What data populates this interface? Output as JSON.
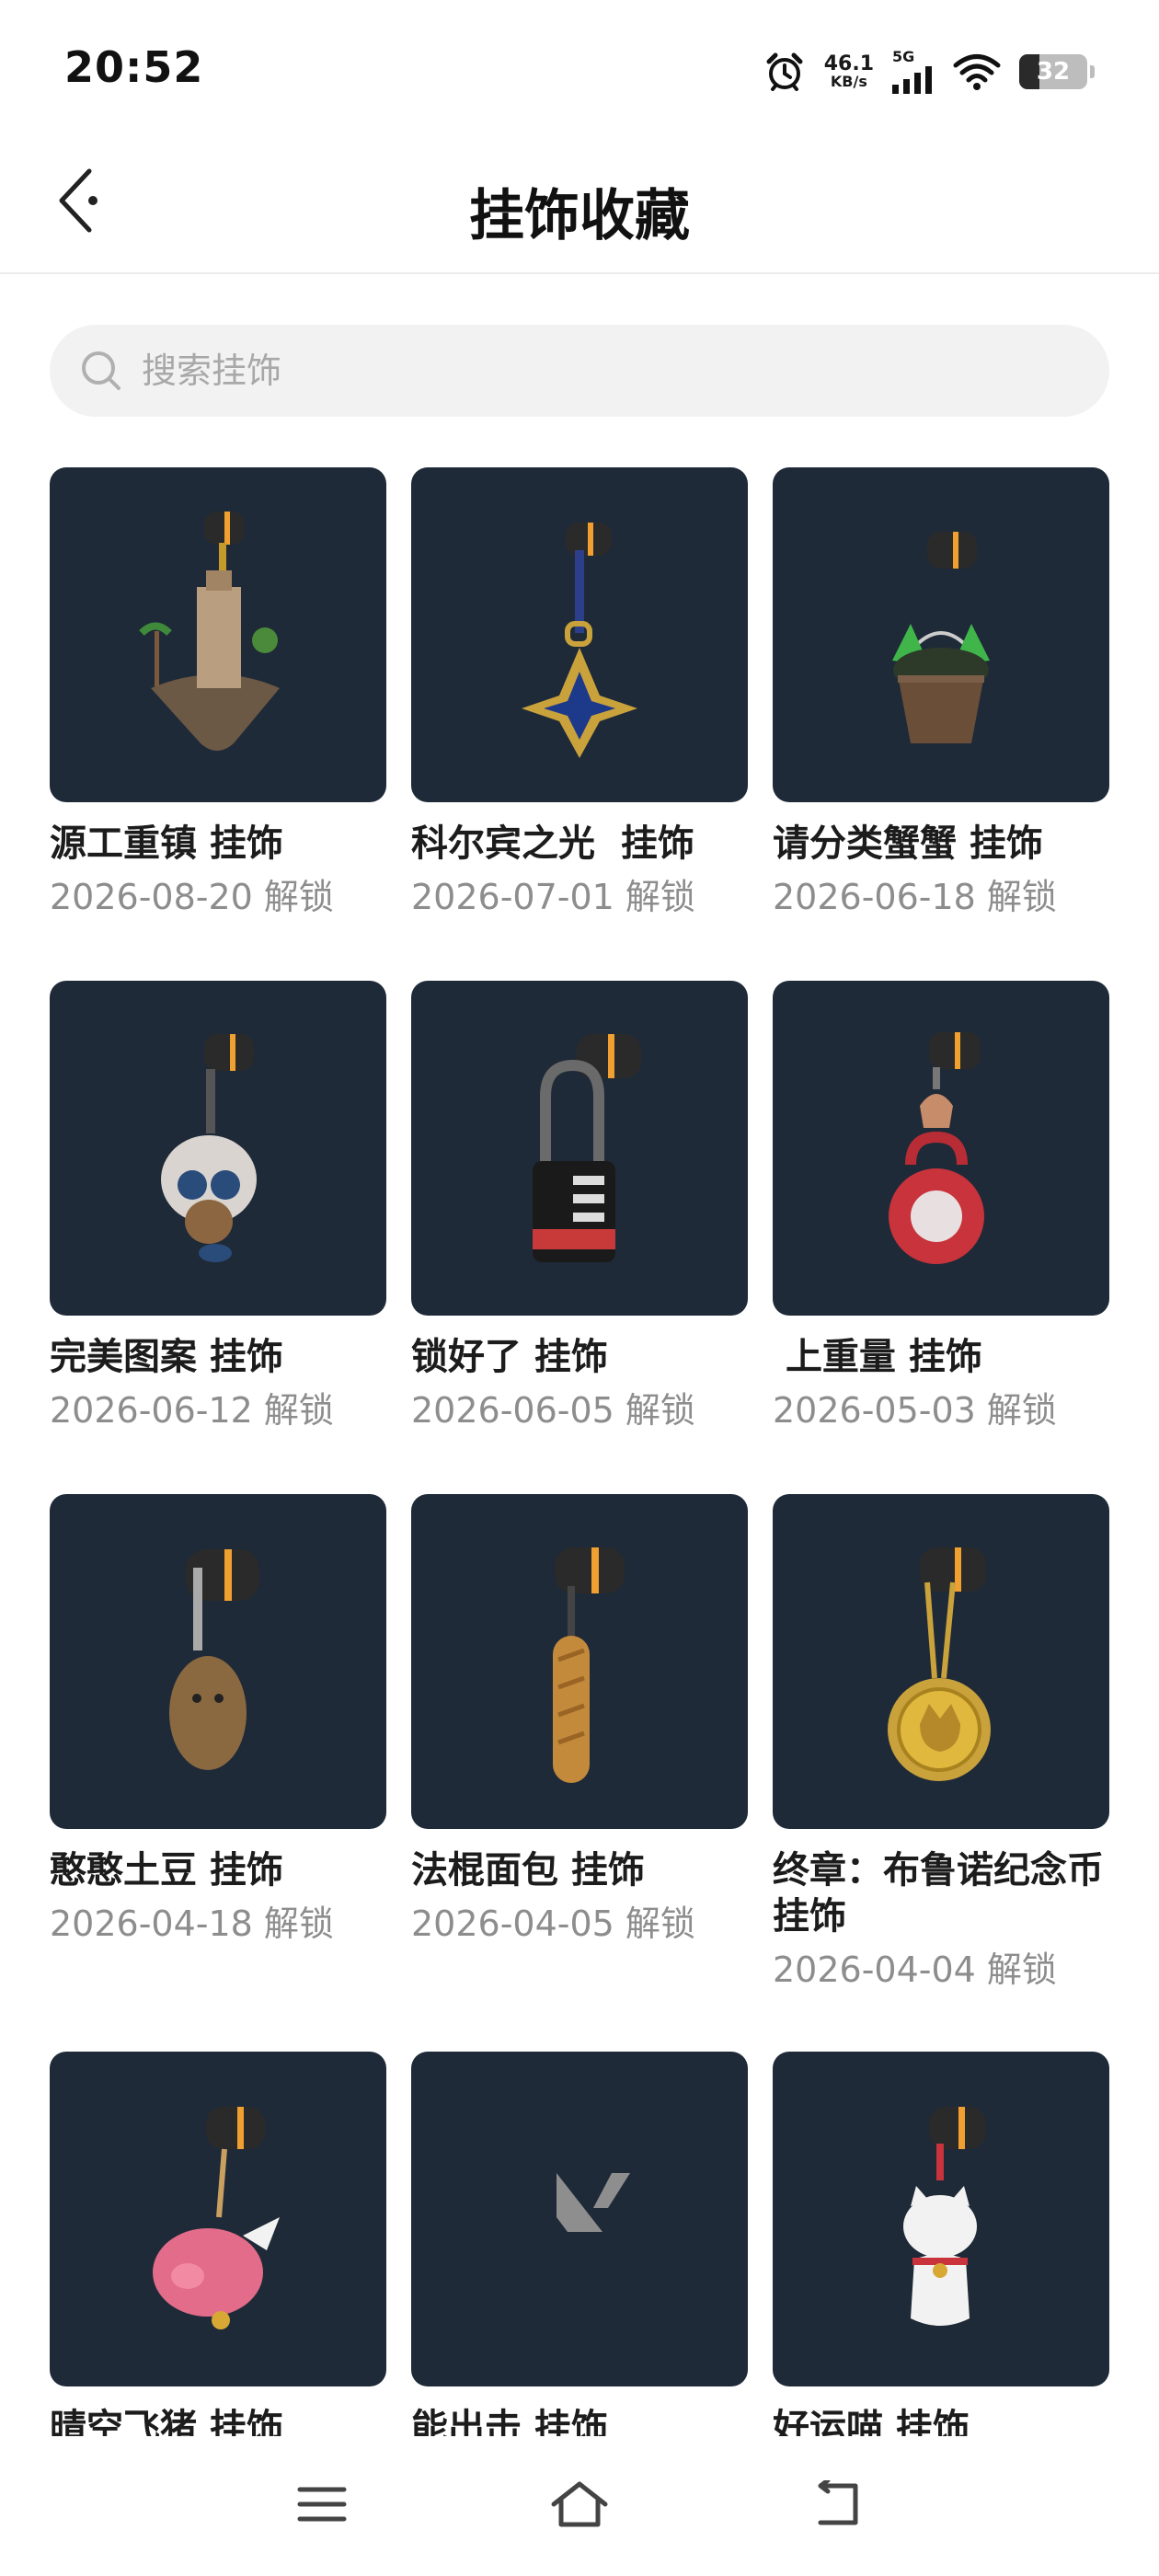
{
  "status_bar": {
    "time": "20:52",
    "net_speed_value": "46.1",
    "net_speed_unit": "KB/s",
    "network_type": "5G",
    "battery_level": "32",
    "icons": [
      "alarm-icon",
      "signal-icon",
      "wifi-icon",
      "battery-icon"
    ]
  },
  "header": {
    "title": "挂饰收藏",
    "back_icon": "back-arrow-icon"
  },
  "search": {
    "placeholder": "搜索挂饰",
    "value": ""
  },
  "items": [
    {
      "name": "源工重镇 挂饰",
      "date": "2026-08-20 解锁",
      "art": "tower-island"
    },
    {
      "name": "科尔宾之光  挂饰",
      "date": "2026-07-01 解锁",
      "art": "star-pendant"
    },
    {
      "name": "请分类蟹蟹 挂饰",
      "date": "2026-06-18 解锁",
      "art": "crab-bucket"
    },
    {
      "name": "完美图案 挂饰",
      "date": "2026-06-12 解锁",
      "art": "owl-doll"
    },
    {
      "name": "锁好了 挂饰",
      "date": "2026-06-05 解锁",
      "art": "padlock"
    },
    {
      "name": " 上重量 挂饰",
      "date": "2026-05-03 解锁",
      "art": "kettlebell"
    },
    {
      "name": "憨憨土豆 挂饰",
      "date": "2026-04-18 解锁",
      "art": "potato"
    },
    {
      "name": "法棍面包 挂饰",
      "date": "2026-04-05 解锁",
      "art": "baguette"
    },
    {
      "name": "终章：布鲁诺纪念币 挂饰",
      "date": "2026-04-04 解锁",
      "art": "coin"
    },
    {
      "name": "晴空飞猪 挂饰",
      "date": "",
      "art": "flying-pig"
    },
    {
      "name": "能出击 挂饰",
      "date": "",
      "art": "v-logo"
    },
    {
      "name": "好运喵 挂饰",
      "date": "",
      "art": "lucky-cat"
    }
  ],
  "colors": {
    "card_bg": "#1f2a38",
    "accent_ring": "#f0a030",
    "title_text": "#111111",
    "date_text": "#8d8d8d",
    "search_bg": "#f2f2f2"
  },
  "nav_bar": {
    "icons": [
      "menu-icon",
      "home-icon",
      "back-icon"
    ]
  }
}
